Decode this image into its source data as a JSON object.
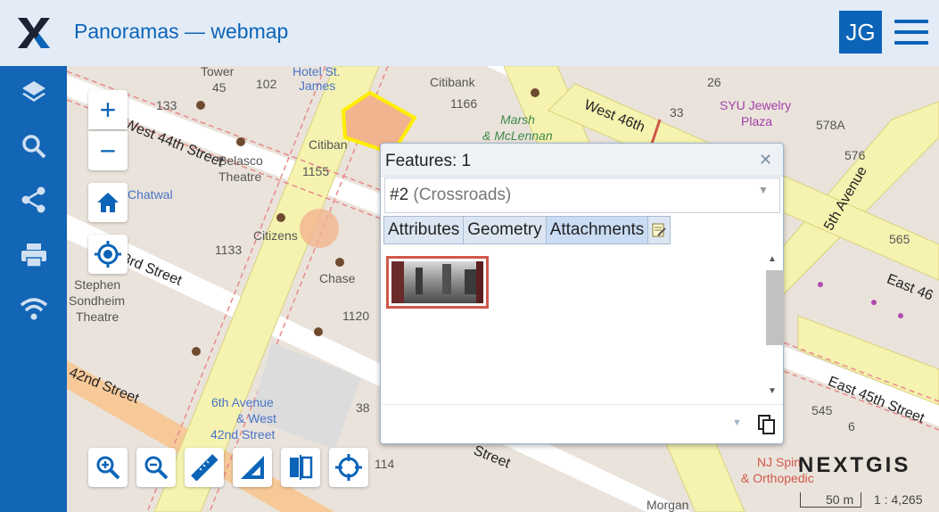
{
  "app": {
    "title": "Panoramas — webmap",
    "user_initials": "JG",
    "accent": "#0b64b8",
    "sidebar_bg": "#1365b5"
  },
  "sidebar": {
    "items": [
      {
        "icon": "layers-icon"
      },
      {
        "icon": "search-icon"
      },
      {
        "icon": "share-icon"
      },
      {
        "icon": "print-icon"
      },
      {
        "icon": "wifi-icon"
      }
    ]
  },
  "map_controls": {
    "zoom_in": "+",
    "zoom_out": "−",
    "home": "home-icon",
    "locate": "locate-icon"
  },
  "map_labels": {
    "tower": "Tower",
    "n45": "45",
    "n102": "102",
    "hotel": "Hotel St.",
    "james": "James",
    "citibank1": "Citibank",
    "n1166": "1166",
    "n26": "26",
    "syu1": "SYU Jewelry",
    "syu2": "Plaza",
    "n133": "133",
    "marsh1": "Marsh",
    "marsh2": "& McLennan",
    "n33": "33",
    "n578a": "578A",
    "n576": "576",
    "citibank2": "Citiban",
    "belasco1": "Belasco",
    "belasco2": "Theatre",
    "n1155": "1155",
    "chatwal": "Chatwal",
    "n1133": "1133",
    "citizens": "Citizens",
    "chase": "Chase",
    "stephen1": "Stephen",
    "stephen2": "Sondheim",
    "stephen3": "Theatre",
    "n1120": "1120",
    "n565": "565",
    "sixth1": "6th Avenue",
    "sixth2": "& West",
    "sixth3": "42nd Street",
    "n38": "38",
    "n114": "114",
    "n545": "545",
    "nj1": "NJ Spin",
    "nj2": "& Orthopedic",
    "morgan": "Morgan",
    "n6": "6"
  },
  "streets": {
    "w44": "West 44th Street",
    "w46": "West 46th",
    "w43": "3rd Street",
    "fifth": "5th Avenue",
    "e45": "East 45th Street",
    "e46": "East 46",
    "w42": "42nd Street",
    "street_bottom": "Street"
  },
  "popup": {
    "title": "Features: 1",
    "select_prefix": "#2",
    "select_name": "(Crossroads)",
    "tabs": [
      "Attributes",
      "Geometry",
      "Attachments"
    ],
    "active_tab": "Attachments",
    "attachment": {
      "kind": "panorama-thumbnail"
    }
  },
  "toolbar": {
    "buttons": [
      "zoom-in-icon",
      "zoom-out-icon",
      "ruler-icon",
      "angle-ruler-icon",
      "swipe-icon",
      "identify-icon"
    ]
  },
  "branding": {
    "text": "NEXTGIS"
  },
  "scale": {
    "distance": "50 m",
    "ratio": "1 : 4,265"
  }
}
